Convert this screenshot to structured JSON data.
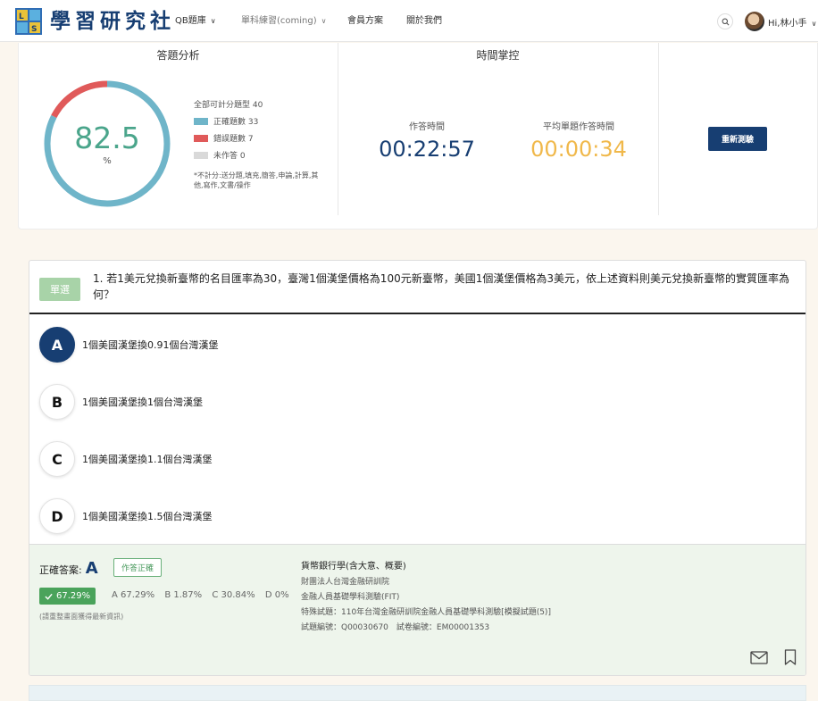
{
  "header": {
    "logo_text": "學習研究社",
    "nav": [
      {
        "label": "QB題庫",
        "has_dropdown": true
      },
      {
        "label": "單科練習(coming)",
        "has_dropdown": true
      },
      {
        "label": "會員方案",
        "has_dropdown": false
      },
      {
        "label": "關於我們",
        "has_dropdown": false
      }
    ],
    "user_greeting": "Hi,林小手"
  },
  "stats": {
    "analysis_title": "答題分析",
    "score": "82.5",
    "score_unit": "%",
    "total_label": "全部可計分題型 40",
    "legend": [
      {
        "label": "正確題數 33",
        "color": "#6fb5c9"
      },
      {
        "label": "錯誤題數 7",
        "color": "#e05a5a"
      },
      {
        "label": "未作答 0",
        "color": "#d9d9d9"
      }
    ],
    "counts": {
      "correct": 33,
      "wrong": 7,
      "unanswered": 0
    },
    "note": "*不計分:送分題,填充,簡答,申論,計算,其他,寫作,文書/操作",
    "time_title": "時間掌控",
    "time_spent_label": "作答時間",
    "time_spent": "00:22:57",
    "avg_time_label": "平均單題作答時間",
    "avg_time": "00:00:34",
    "retake_label": "重新測驗",
    "colors": {
      "score": "#4aa58b",
      "time_spent": "#173e72",
      "avg_time": "#f0b84a"
    }
  },
  "question": {
    "type_badge": "單選",
    "text": "1. 若1美元兌換新臺幣的名目匯率為30，臺灣1個漢堡價格為100元新臺幣，美國1個漢堡價格為3美元，依上述資料則美元兌換新臺幣的實質匯率為何？",
    "options": [
      {
        "letter": "A",
        "text": "1個美國漢堡換0.91個台灣漢堡",
        "selected": true
      },
      {
        "letter": "B",
        "text": "1個美國漢堡換1個台灣漢堡",
        "selected": false
      },
      {
        "letter": "C",
        "text": "1個美國漢堡換1.1個台灣漢堡",
        "selected": false
      },
      {
        "letter": "D",
        "text": "1個美國漢堡換1.5個台灣漢堡",
        "selected": false
      }
    ]
  },
  "answer": {
    "correct_label": "正確答案:",
    "correct_letter": "A",
    "status": "作答正確",
    "rate": "67.29%",
    "distribution": [
      "A 67.29%",
      "B 1.87%",
      "C 30.84%",
      "D 0%"
    ],
    "refresh_note": "(請重整畫面獲得最新資訊)",
    "subject": "貨幣銀行學(含大意、概要)",
    "org": "財團法人台灣金融研訓院",
    "exam": "金融人員基礎學科測驗(FIT)",
    "special": "特殊試題：110年台灣金融研訓院金融人員基礎學科測驗[模擬試題(5)]",
    "ids": "試題編號：Q00030670　試卷編號：EM00001353"
  }
}
